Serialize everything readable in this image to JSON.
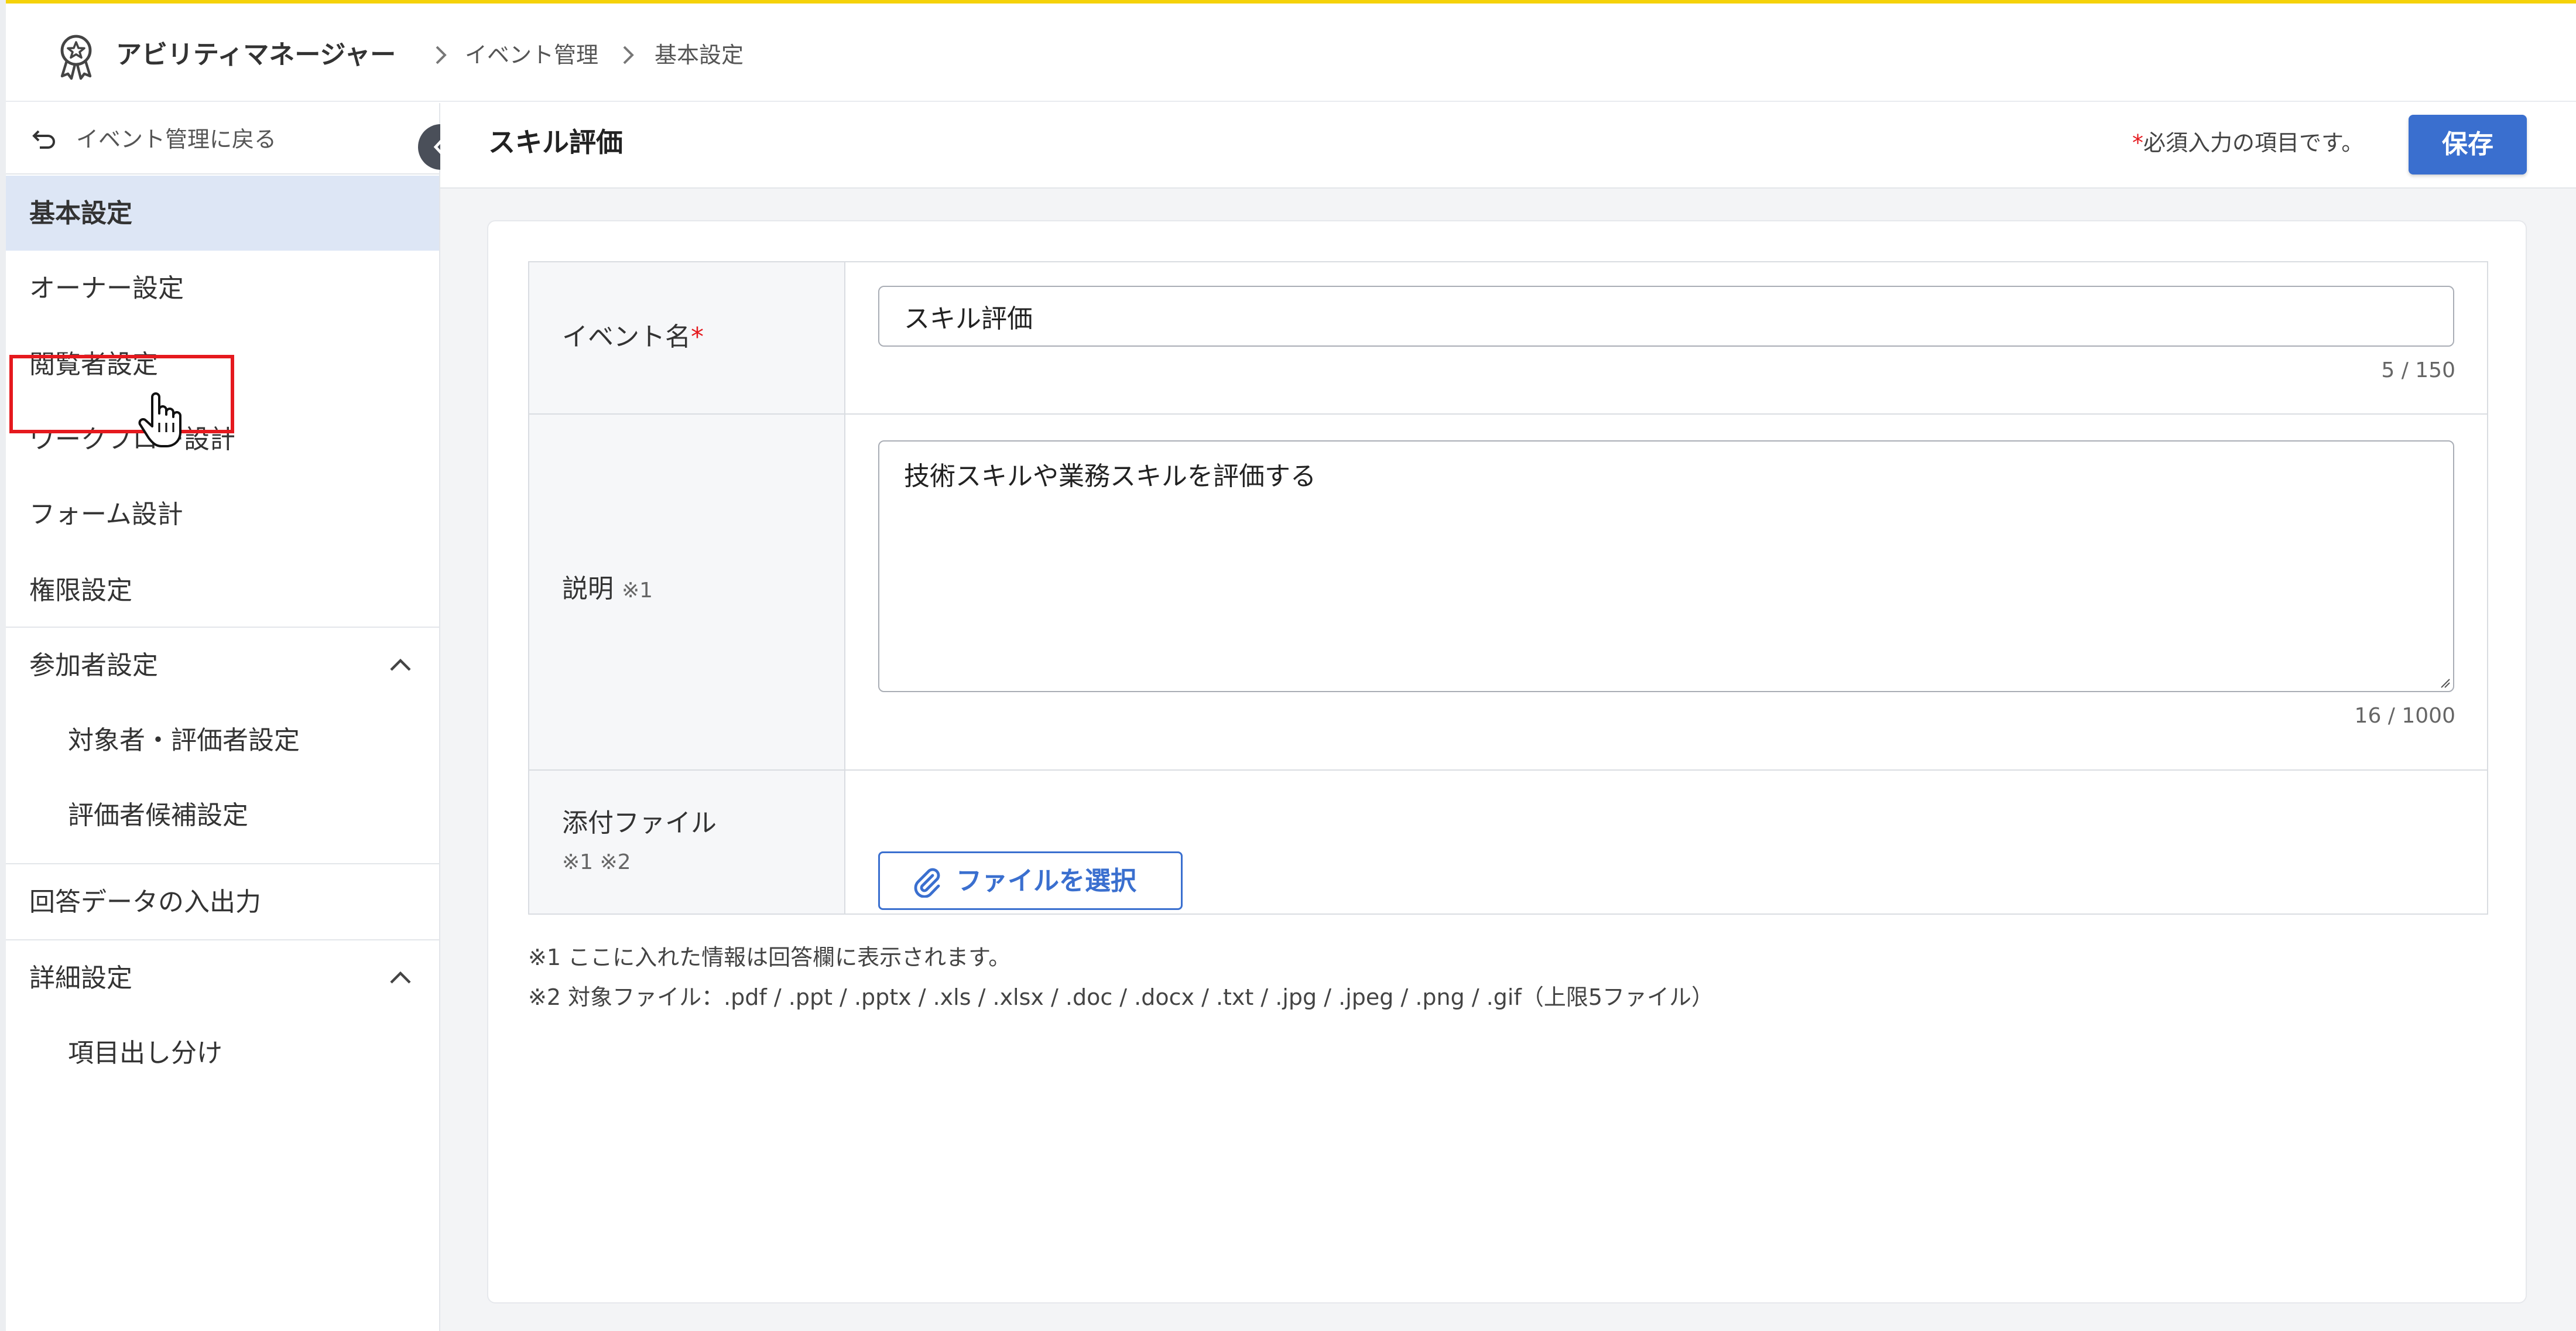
{
  "header": {
    "app_name": "アビリティマネージャー",
    "breadcrumbs": [
      "イベント管理",
      "基本設定"
    ],
    "accent_color": "#f5d20a"
  },
  "sidebar": {
    "back_label": "イベント管理に戻る",
    "items": [
      {
        "label": "基本設定",
        "active": true
      },
      {
        "label": "オーナー設定",
        "highlighted": true
      },
      {
        "label": "閲覧者設定"
      },
      {
        "label": "ワークフロー設計"
      },
      {
        "label": "フォーム設計"
      },
      {
        "label": "権限設定"
      }
    ],
    "participants_group": {
      "label": "参加者設定",
      "expanded": true,
      "children": [
        "対象者・評価者設定",
        "評価者候補設定"
      ]
    },
    "data_io_label": "回答データの入出力",
    "advanced_group": {
      "label": "詳細設定",
      "expanded": true,
      "children": [
        "項目出し分け"
      ]
    }
  },
  "page": {
    "title": "スキル評価",
    "required_note_mark": "*",
    "required_note": "必須入力の項目です。",
    "save_label": "保存",
    "primary_color": "#3a6fcf"
  },
  "form": {
    "event_name": {
      "label": "イベント名",
      "required_mark": "*",
      "value": "スキル評価",
      "counter": "5 / 150"
    },
    "description": {
      "label": "説明",
      "note": "※1",
      "value": "技術スキルや業務スキルを評価する",
      "counter": "16 / 1000"
    },
    "attachment": {
      "label": "添付ファイル",
      "note": "※1 ※2",
      "button_label": "ファイルを選択"
    }
  },
  "footnotes": [
    "※1 ここに入れた情報は回答欄に表示されます。",
    "※2 対象ファイル：.pdf / .ppt / .pptx / .xls / .xlsx / .doc / .docx / .txt / .jpg / .jpeg / .png / .gif（上限5ファイル）"
  ],
  "icons": [
    "award-badge-icon",
    "chevron-right-icon",
    "undo-icon",
    "chevron-left-icon",
    "chevron-up-icon",
    "paperclip-icon",
    "hand-pointer-icon"
  ]
}
